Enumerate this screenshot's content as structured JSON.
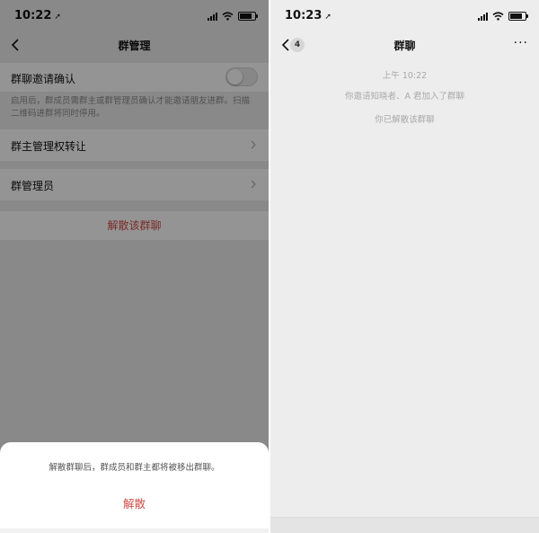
{
  "left_screen": {
    "status_time": "10:22",
    "nav_title": "群管理",
    "invite_confirm": {
      "label": "群聊邀请确认",
      "enabled": false
    },
    "invite_note": "启用后，群成员需群主或群管理员确认才能邀请朋友进群。扫描二维码进群将同时停用。",
    "transfer_label": "群主管理权转让",
    "admins_label": "群管理员",
    "disband_label": "解散该群聊",
    "sheet": {
      "message": "解散群聊后，群成员和群主都将被移出群聊。",
      "confirm_label": "解散"
    }
  },
  "right_screen": {
    "status_time": "10:23",
    "back_badge": "4",
    "nav_title": "群聊",
    "more_label": "···",
    "messages": [
      "上午 10:22",
      "你邀请知晓者、A 君加入了群聊",
      "你已解散该群聊"
    ]
  },
  "colors": {
    "accent_red": "#d14d47",
    "background": "#ededed",
    "overlay": "rgba(0,0,0,0.42)"
  },
  "icons": [
    "location-arrow-icon",
    "signal-icon",
    "wifi-icon",
    "battery-icon",
    "back-chevron-icon",
    "chevron-right-icon",
    "more-icon"
  ]
}
